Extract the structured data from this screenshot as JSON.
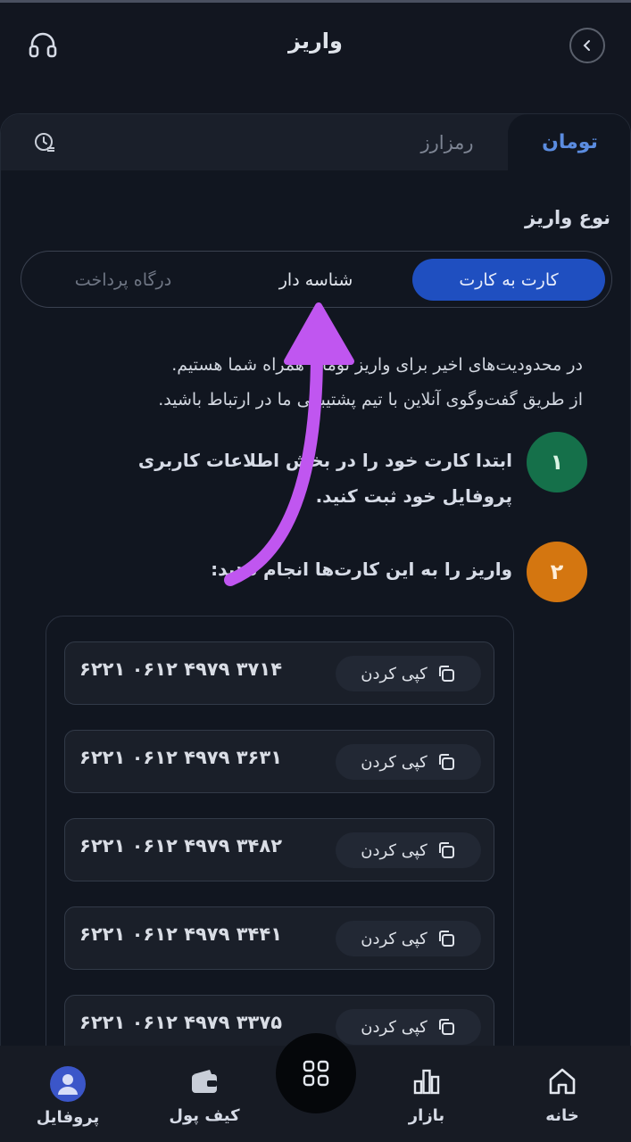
{
  "header": {
    "title": "واریز"
  },
  "tabs": [
    {
      "label": "تومان",
      "active": true
    },
    {
      "label": "رمزارز",
      "active": false
    }
  ],
  "deposit_type": {
    "label": "نوع واریز",
    "options": [
      {
        "label": "کارت به کارت",
        "active": true
      },
      {
        "label": "شناسه دار",
        "active": false
      },
      {
        "label": "درگاه پرداخت",
        "active": false
      }
    ]
  },
  "notice": {
    "line1": "در محدودیت‌های اخیر برای واریز تومان همراه شما هستیم.",
    "line2": "از طریق گفت‌وگوی آنلاین با تیم پشتیبانی ما در ارتباط باشید."
  },
  "steps": [
    {
      "number": "۱",
      "text": "ابتدا کارت خود را در بخش اطلاعات کاربری پروفایل خود ثبت کنید."
    },
    {
      "number": "۲",
      "text": "واریز را به این کارت‌ها انجام دهید:"
    }
  ],
  "cards": [
    {
      "number": "۶۲۲۱ ۰۶۱۲ ۴۹۷۹ ۳۷۱۴",
      "copy_label": "کپی کردن"
    },
    {
      "number": "۶۲۲۱ ۰۶۱۲ ۴۹۷۹ ۳۶۳۱",
      "copy_label": "کپی کردن"
    },
    {
      "number": "۶۲۲۱ ۰۶۱۲ ۴۹۷۹ ۳۴۸۲",
      "copy_label": "کپی کردن"
    },
    {
      "number": "۶۲۲۱ ۰۶۱۲ ۴۹۷۹ ۳۴۴۱",
      "copy_label": "کپی کردن"
    },
    {
      "number": "۶۲۲۱ ۰۶۱۲ ۴۹۷۹ ۳۳۷۵",
      "copy_label": "کپی کردن"
    }
  ],
  "bottom_nav": {
    "home": "خانه",
    "market": "بازار",
    "wallet": "کیف پول",
    "profile": "پروفایل"
  },
  "colors": {
    "accent_blue": "#1f4fc0",
    "step1_green": "#15704a",
    "step2_orange": "#d47610",
    "annotation_arrow": "#c056f0"
  },
  "icons": {
    "back": "chevron-left-icon",
    "support": "headset-icon",
    "history": "history-icon",
    "copy": "copy-icon",
    "home": "home-icon",
    "market": "bar-chart-icon",
    "menu": "grid-icon",
    "wallet": "wallet-icon",
    "profile": "avatar-icon"
  }
}
